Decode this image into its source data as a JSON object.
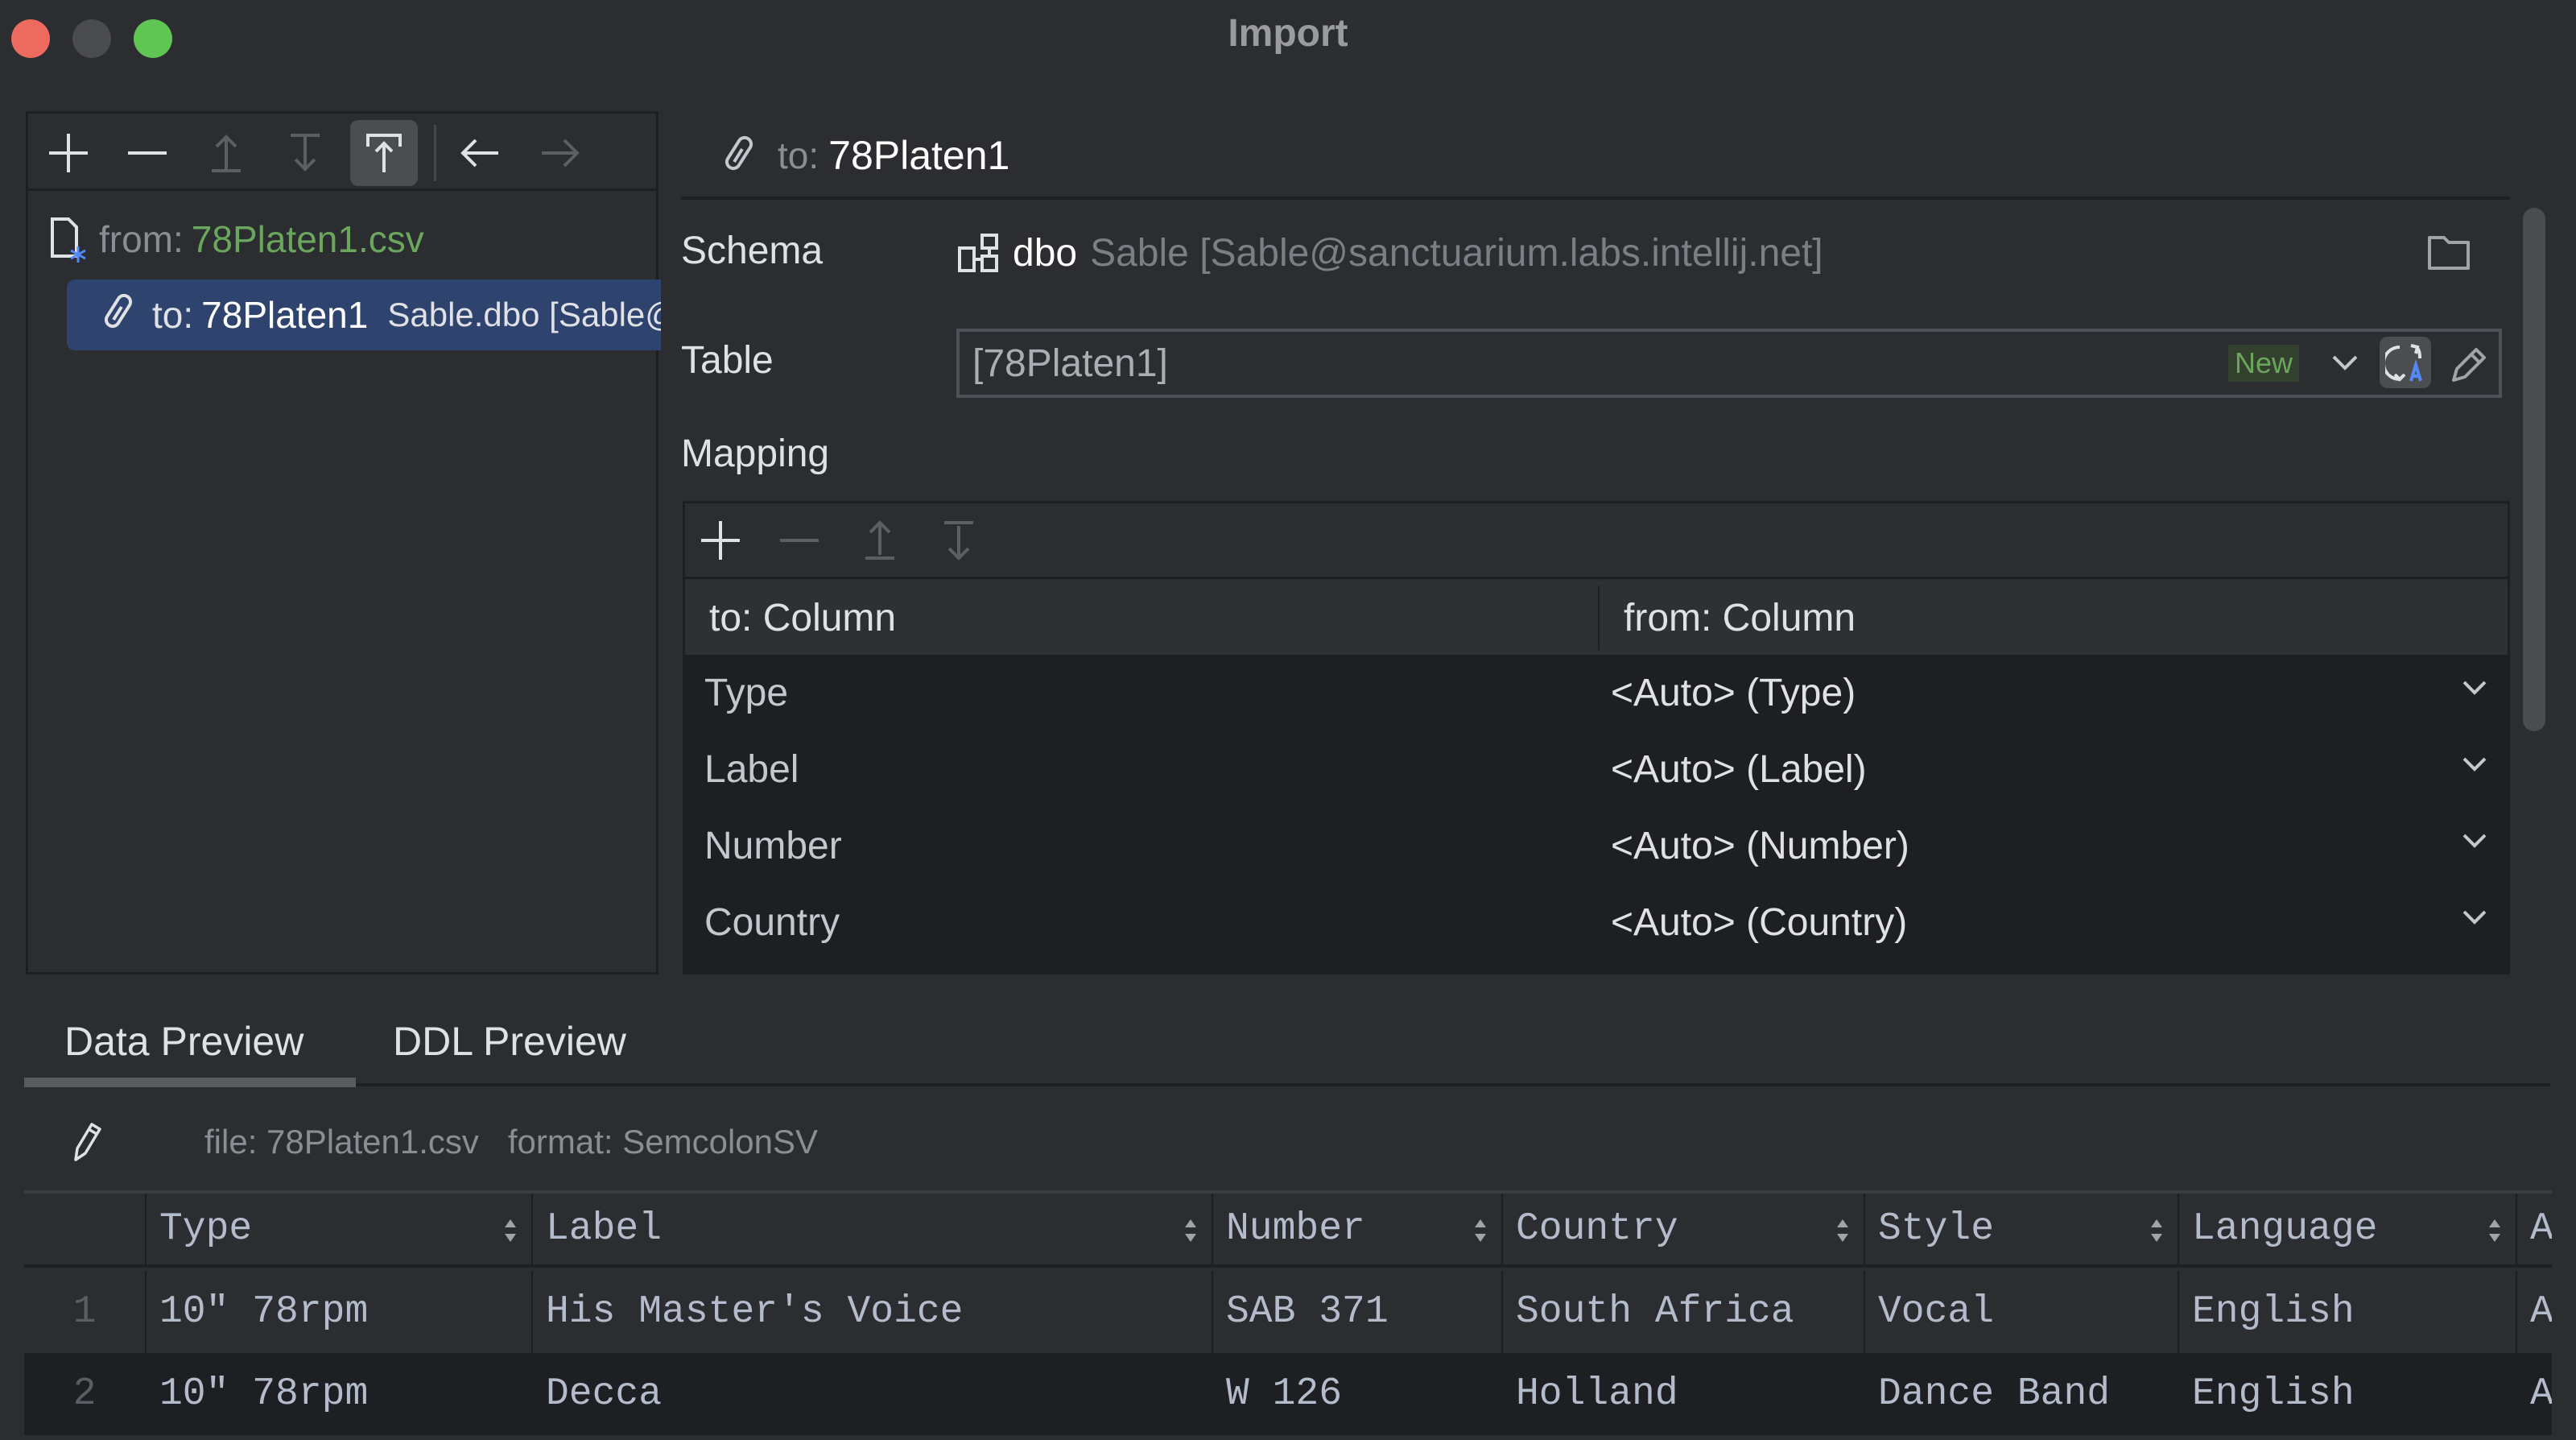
{
  "window": {
    "title": "Import",
    "traffic_lights": {
      "close": "#ec6a5e",
      "minimize": "#4a4b4d",
      "zoom": "#61c554"
    }
  },
  "left_panel": {
    "toolbar": [
      {
        "name": "add-icon",
        "enabled": true
      },
      {
        "name": "remove-icon",
        "enabled": true
      },
      {
        "name": "move-up-icon",
        "enabled": false
      },
      {
        "name": "move-down-icon",
        "enabled": false
      },
      {
        "name": "move-to-top-icon",
        "enabled": true,
        "active": true
      },
      {
        "name": "back-arrow-icon",
        "enabled": true
      },
      {
        "name": "forward-arrow-icon",
        "enabled": false
      }
    ],
    "tree": {
      "source_prefix": "from:",
      "source_file": "78Platen1.csv",
      "target_prefix": "to:",
      "target_name": "78Platen1",
      "target_location": "Sable.dbo [Sable@sanctuarium.labs.intellij.net]"
    }
  },
  "target": {
    "header_prefix": "to:",
    "header_name": "78Platen1",
    "schema_label": "Schema",
    "schema_name": "dbo",
    "schema_location": "Sable [Sable@sanctuarium.labs.intellij.net]",
    "table_label": "Table",
    "table_value": "[78Platen1]",
    "table_badge": "New",
    "mapping_label": "Mapping",
    "mapping_columns": {
      "to": "to: Column",
      "from": "from: Column"
    },
    "mapping_rows": [
      {
        "to": "Type",
        "from": "<Auto> (Type)"
      },
      {
        "to": "Label",
        "from": "<Auto> (Label)"
      },
      {
        "to": "Number",
        "from": "<Auto> (Number)"
      },
      {
        "to": "Country",
        "from": "<Auto> (Country)"
      }
    ]
  },
  "preview": {
    "tabs": [
      {
        "label": "Data Preview",
        "selected": true
      },
      {
        "label": "DDL Preview",
        "selected": false
      }
    ],
    "file_info": "file: 78Platen1.csv",
    "format_info": "format: SemcolonSV",
    "columns": [
      "Type",
      "Label",
      "Number",
      "Country",
      "Style",
      "Language",
      "A"
    ],
    "rows": [
      {
        "num": "1",
        "cells": [
          "10\" 78rpm",
          "His Master's Voice",
          "SAB 371",
          "South Africa",
          "Vocal",
          "English",
          "Ac"
        ]
      },
      {
        "num": "2",
        "cells": [
          "10\" 78rpm",
          "Decca",
          "W 126",
          "Holland",
          "Dance Band",
          "English",
          "A'"
        ]
      }
    ]
  },
  "colors": {
    "background": "#2b2d30",
    "selection": "#2e436e",
    "file_green": "#6aa75d",
    "badge_new_bg": "#33412e",
    "accent_blue": "#548af7"
  }
}
